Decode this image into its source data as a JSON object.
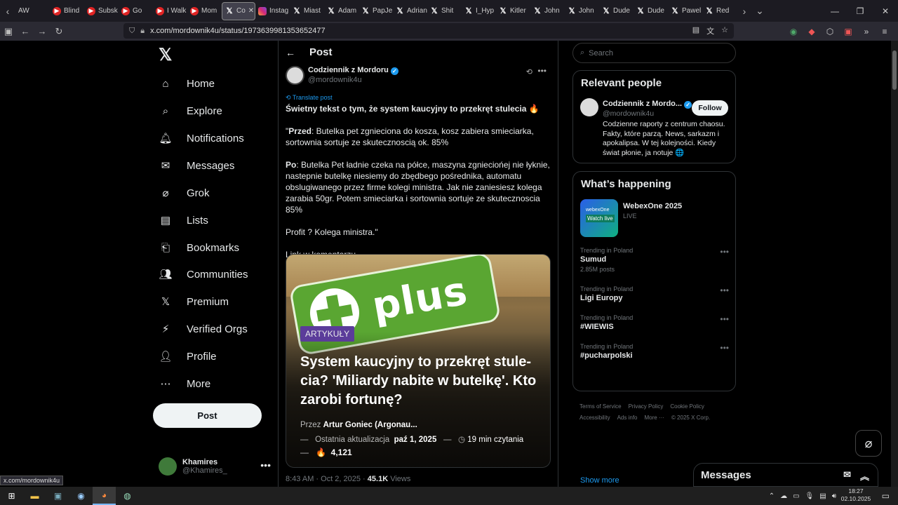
{
  "browser": {
    "tabs": [
      {
        "label": "AW",
        "icon": "none"
      },
      {
        "label": "Blind",
        "icon": "youtube-icon"
      },
      {
        "label": "Subsk",
        "icon": "youtube-icon"
      },
      {
        "label": "Go",
        "icon": "youtube-icon"
      },
      {
        "label": "I Walk",
        "icon": "youtube-icon"
      },
      {
        "label": "Mom",
        "icon": "youtube-icon"
      },
      {
        "label": "Co",
        "icon": "x-icon",
        "active": true
      },
      {
        "label": "Instag",
        "icon": "instagram-icon"
      },
      {
        "label": "Miast",
        "icon": "x-icon"
      },
      {
        "label": "Adam",
        "icon": "x-icon"
      },
      {
        "label": "PapJe",
        "icon": "x-icon"
      },
      {
        "label": "Adrian",
        "icon": "x-icon"
      },
      {
        "label": "Shit",
        "icon": "x-icon"
      },
      {
        "label": "I_Hyp",
        "icon": "x-icon"
      },
      {
        "label": "Kitler",
        "icon": "x-icon"
      },
      {
        "label": "John",
        "icon": "x-icon"
      },
      {
        "label": "John",
        "icon": "x-icon"
      },
      {
        "label": "Dude",
        "icon": "x-icon"
      },
      {
        "label": "Dude",
        "icon": "x-icon"
      },
      {
        "label": "Pawel",
        "icon": "x-icon"
      },
      {
        "label": "Red",
        "icon": "x-icon"
      }
    ],
    "url": "x.com/mordownik4u/status/1973639981353652477",
    "status_link": "x.com/mordownik4u"
  },
  "nav": {
    "items": [
      {
        "label": "Home",
        "icon": "home-icon"
      },
      {
        "label": "Explore",
        "icon": "search-icon"
      },
      {
        "label": "Notifications",
        "icon": "bell-icon"
      },
      {
        "label": "Messages",
        "icon": "envelope-icon"
      },
      {
        "label": "Grok",
        "icon": "grok-icon"
      },
      {
        "label": "Lists",
        "icon": "list-icon"
      },
      {
        "label": "Bookmarks",
        "icon": "bookmark-icon"
      },
      {
        "label": "Communities",
        "icon": "people-icon"
      },
      {
        "label": "Premium",
        "icon": "x-icon"
      },
      {
        "label": "Verified Orgs",
        "icon": "lightning-icon"
      },
      {
        "label": "Profile",
        "icon": "person-icon"
      },
      {
        "label": "More",
        "icon": "more-circle-icon"
      }
    ],
    "post_button": "Post",
    "user": {
      "name": "Khamires",
      "handle": "@Khamires_"
    }
  },
  "post": {
    "header": "Post",
    "author_name": "Codziennik z Mordoru",
    "author_handle": "@mordownik4u",
    "translate": "Translate post",
    "lead": "Świetny tekst o tym, że system kaucyjny to przekręt stulecia 🔥",
    "para1_label": "Przed",
    "para1": "\"Przed: Butelka pet zgnieciona do kosza, kosz zabiera smieciarka, sortownia sortuje ze skutecznoscią ok. 85%",
    "para2_label": "Po",
    "para2": "Po: Butelka Pet ładnie czeka na półce, maszyna zgnieciońej nie łyknie, nastepnie butelkę niesiemy do zbędbego pośrednika, automatu obslugiwanego przez firme kolegi ministra. Jak nie zaniesiesz kolega zarabia 50gr. Potem smieciarka i sortownia sortuje ze skutecznoscia 85%",
    "para3": "Profit ? Kolega ministra.\"",
    "para4": "Link w komentarzu.",
    "card": {
      "banner_text": "plus",
      "badge": "ARTYKUŁY",
      "headline": "System kaucyjny to przekręt stule-cia? 'Miliardy nabite w butelkę'. Kto zarobi fortunę?",
      "by_label": "Przez",
      "author": "Artur Goniec (Argonau...",
      "dash": "—",
      "updated_label": "Ostatnia aktualizacja",
      "updated_date": "paź 1, 2025",
      "read_time": "19 min czytania",
      "likes": "4,121"
    },
    "time": "8:43 AM · Oct 2, 2025 · ",
    "views_count": "45.1K",
    "views_label": "Views"
  },
  "right": {
    "search_placeholder": "Search",
    "relevant_title": "Relevant people",
    "person": {
      "name": "Codziennik z Mordo...",
      "handle": "@mordownik4u",
      "follow": "Follow",
      "bio": "Codzienne raporty z centrum chaosu. Fakty, które parzą. News, sarkazm i apokalipsa. W tej kolejności. Kiedy świat płonie, ja notuje 🌐"
    },
    "happening_title": "What’s happening",
    "event": {
      "title": "WebexOne 2025",
      "status": "LIVE",
      "img_line1": "webexOne",
      "img_line2": "Watch live"
    },
    "trends": [
      {
        "context": "Trending in Poland",
        "name": "Sumud",
        "count": "2.85M posts"
      },
      {
        "context": "Trending in Poland",
        "name": "Ligi Europy",
        "count": ""
      },
      {
        "context": "Trending in Poland",
        "name": "#WIEWIS",
        "count": ""
      },
      {
        "context": "Trending in Poland",
        "name": "#pucharpolski",
        "count": ""
      }
    ],
    "show_more": "Show more",
    "footer": [
      "Terms of Service",
      "Privacy Policy",
      "Cookie Policy",
      "Accessibility",
      "Ads info",
      "More ···",
      "© 2025 X Corp."
    ]
  },
  "messages_drawer": "Messages",
  "taskbar": {
    "time": "18:27",
    "date": "02.10.2025"
  }
}
